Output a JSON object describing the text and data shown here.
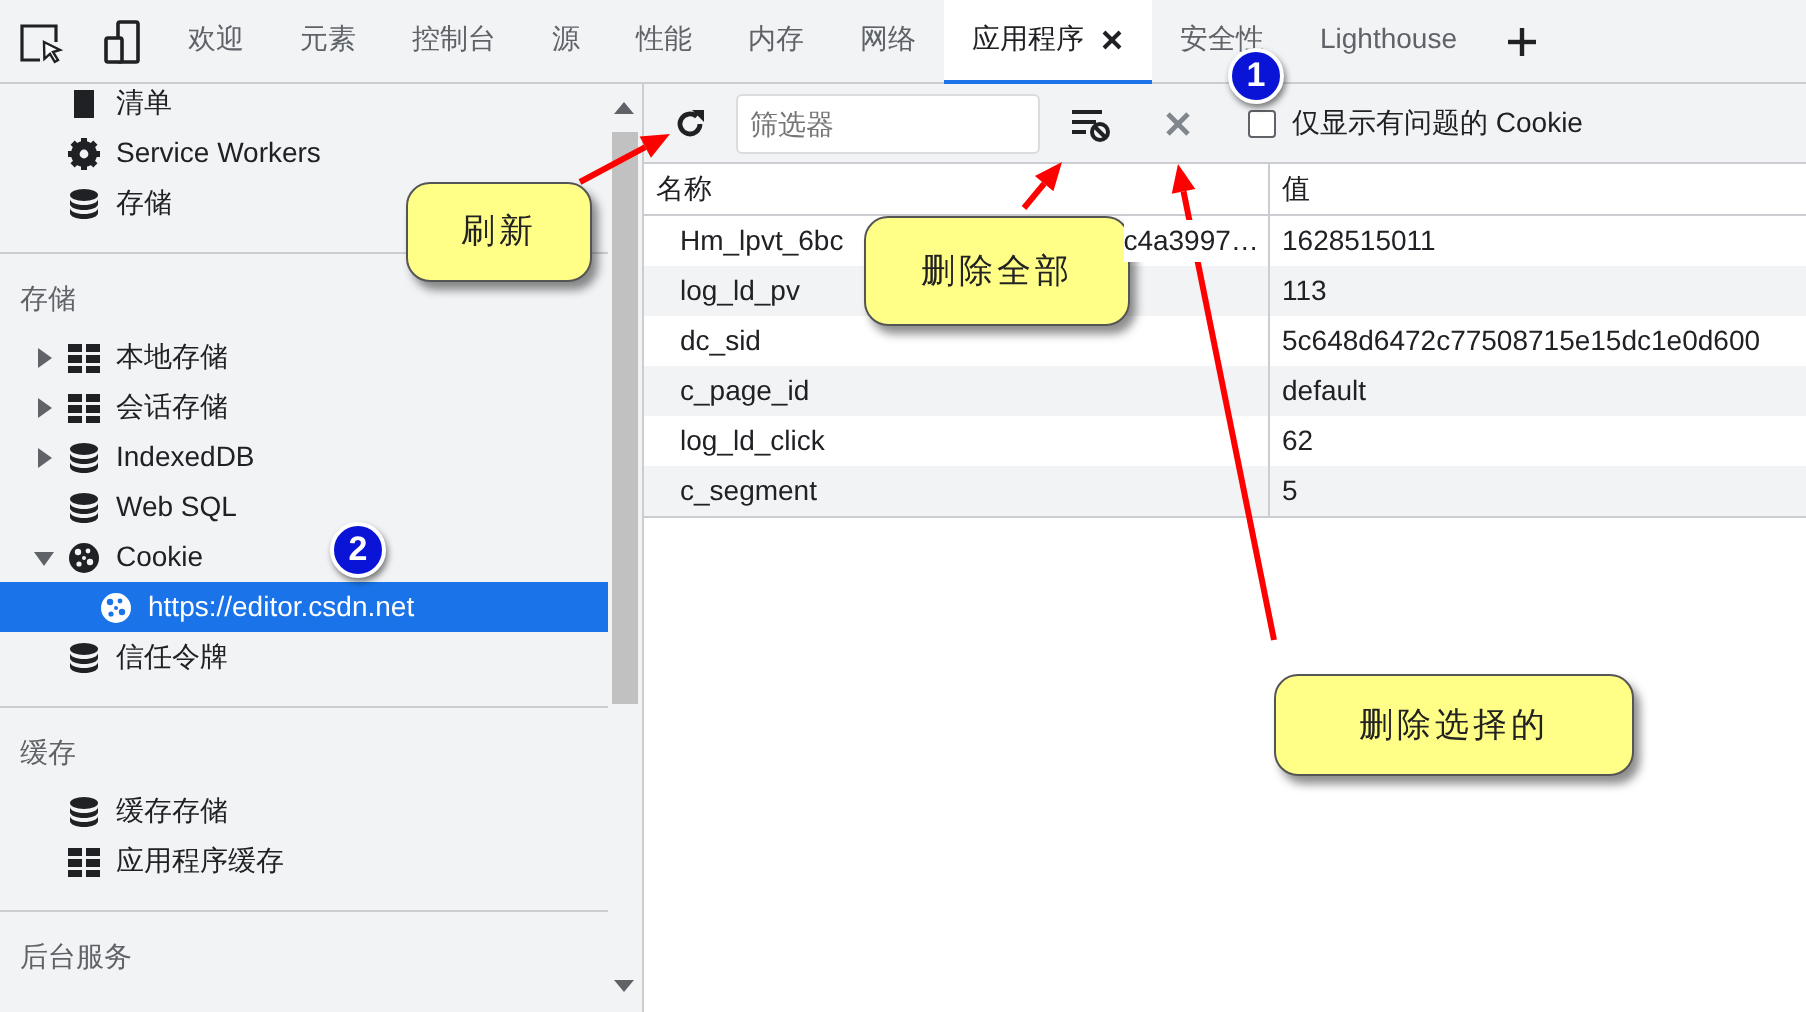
{
  "tabs": [
    {
      "label": "欢迎",
      "selected": false
    },
    {
      "label": "元素",
      "selected": false
    },
    {
      "label": "控制台",
      "selected": false
    },
    {
      "label": "源",
      "selected": false
    },
    {
      "label": "性能",
      "selected": false
    },
    {
      "label": "内存",
      "selected": false
    },
    {
      "label": "网络",
      "selected": false
    },
    {
      "label": "应用程序",
      "selected": true
    },
    {
      "label": "安全性",
      "selected": false
    },
    {
      "label": "Lighthouse",
      "selected": false
    }
  ],
  "sidebar": {
    "sections": [
      {
        "items": [
          {
            "label": "清单",
            "kind": "file",
            "selected": false
          },
          {
            "label": "Service Workers",
            "kind": "gear",
            "selected": false
          },
          {
            "label": "存储",
            "kind": "database",
            "selected": false
          }
        ]
      },
      {
        "heading": "存储",
        "items": [
          {
            "label": "本地存储",
            "kind": "grid",
            "expanded": false,
            "selected": false
          },
          {
            "label": "会话存储",
            "kind": "grid",
            "expanded": false,
            "selected": false
          },
          {
            "label": "IndexedDB",
            "kind": "database",
            "expanded": false,
            "selected": false
          },
          {
            "label": "Web SQL",
            "kind": "database",
            "selected": false
          },
          {
            "label": "Cookie",
            "kind": "cookie",
            "expanded": true,
            "selected": false,
            "children": [
              {
                "label": "https://editor.csdn.net",
                "kind": "cookie",
                "selected": true
              }
            ]
          },
          {
            "label": "信任令牌",
            "kind": "database",
            "selected": false
          }
        ]
      },
      {
        "heading": "缓存",
        "items": [
          {
            "label": "缓存存储",
            "kind": "database",
            "selected": false
          },
          {
            "label": "应用程序缓存",
            "kind": "grid",
            "selected": false
          }
        ]
      },
      {
        "heading": "后台服务"
      }
    ]
  },
  "toolbar": {
    "filter": {
      "placeholder": "筛选器"
    },
    "only_issues": {
      "label": "仅显示有问题的 Cookie",
      "checked": false
    }
  },
  "table": {
    "columns": [
      "名称",
      "值"
    ],
    "rows": [
      {
        "name_fragments": [
          "Hm_lpvt_6bc",
          "c4a3997…"
        ],
        "value": "1628515011"
      },
      {
        "name": "log_ld_pv",
        "value": "113"
      },
      {
        "name": "dc_sid",
        "value": "5c648d6472c77508715e15dc1e0d600"
      },
      {
        "name": "c_page_id",
        "value": "default"
      },
      {
        "name": "log_ld_click",
        "value": "62"
      },
      {
        "name": "c_segment",
        "value": "5"
      }
    ]
  },
  "annotations": {
    "callouts": [
      "刷新",
      "删除全部",
      "删除选择的"
    ],
    "badges": [
      "1",
      "2"
    ]
  }
}
